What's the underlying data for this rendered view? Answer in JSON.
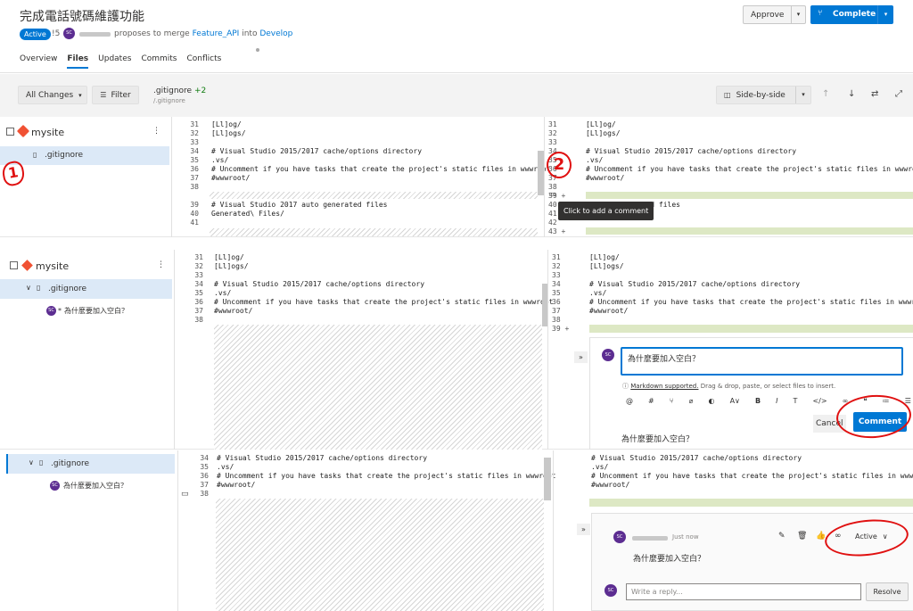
{
  "pr": {
    "title": "完成電話號碼維護功能",
    "status": "Active",
    "id": "!5",
    "avatar": "SC",
    "proposes": "proposes to merge",
    "source": "Feature_API",
    "into": "into",
    "target": "Develop"
  },
  "buttons": {
    "approve": "Approve",
    "complete": "Complete"
  },
  "tabs": [
    "Overview",
    "Files",
    "Updates",
    "Commits",
    "Conflicts"
  ],
  "toolbar": {
    "all_changes": "All Changes",
    "filter": "Filter",
    "file": ".gitignore",
    "delta": "+2",
    "path": "/.gitignore",
    "view": "Side-by-side"
  },
  "tree": {
    "repo": "mysite",
    "file": ".gitignore",
    "comment": "為什麼要加入空白？",
    "comment_bullet": "*"
  },
  "diff1": {
    "left_nums": [
      "31",
      "32",
      "33",
      "34",
      "35",
      "36",
      "37",
      "38",
      "",
      "39",
      "40",
      "41"
    ],
    "left_code": [
      "[Ll]og/",
      "[Ll]ogs/",
      "",
      "# Visual Studio 2015/2017 cache/options directory",
      ".vs/",
      "# Uncomment if you have tasks that create the project's static files in wwwroot",
      "#wwwroot/",
      "",
      "",
      "# Visual Studio 2017 auto generated files",
      "Generated\\ Files/",
      ""
    ],
    "right_nums": [
      "31",
      "32",
      "33",
      "34",
      "35",
      "36",
      "37",
      "38",
      "39 +",
      "40",
      "41",
      "42",
      "43 +"
    ],
    "right_code": [
      "[Ll]og/",
      "[Ll]ogs/",
      "",
      "# Visual Studio 2015/2017 cache/options directory",
      ".vs/",
      "# Uncomment if you have tasks that create the project's static files in wwwroot",
      "#wwwroot/",
      "",
      "",
      "7 auto generated files",
      "",
      "",
      ""
    ],
    "tooltip": "Click to add a comment"
  },
  "diff2": {
    "left_nums": [
      "31",
      "32",
      "33",
      "34",
      "35",
      "36",
      "37",
      "38"
    ],
    "left_code": [
      "[Ll]og/",
      "[Ll]ogs/",
      "",
      "# Visual Studio 2015/2017 cache/options directory",
      ".vs/",
      "# Uncomment if you have tasks that create the project's static files in wwwroot",
      "#wwwroot/",
      ""
    ],
    "right_nums": [
      "31",
      "32",
      "33",
      "34",
      "35",
      "36",
      "37",
      "38",
      "39 +"
    ],
    "right_code": [
      "[Ll]og/",
      "[Ll]ogs/",
      "",
      "# Visual Studio 2015/2017 cache/options directory",
      ".vs/",
      "# Uncomment if you have tasks that create the project's static files in wwwroot",
      "#wwwroot/",
      "",
      ""
    ],
    "comment_input": "為什麼要加入空白？",
    "markdown_link": "Markdown supported.",
    "markdown_hint": " Drag & drop, paste, or select files to insert.",
    "cancel": "Cancel",
    "comment": "Comment",
    "preview": "為什麼要加入空白？"
  },
  "diff3": {
    "left_nums": [
      "34",
      "35",
      "36",
      "37",
      "38"
    ],
    "left_code": [
      "# Visual Studio 2015/2017 cache/options directory",
      ".vs/",
      "# Uncomment if you have tasks that create the project's static files in wwwroot",
      "#wwwroot/",
      ""
    ],
    "right_code": [
      "# Visual Studio 2015/2017 cache/options directory",
      ".vs/",
      "# Uncomment if you have tasks that create the project's static files in wwwroot",
      "#wwwroot/",
      ""
    ],
    "time": "Just now",
    "comment": "為什麼要加入空白？",
    "status": "Active",
    "reply_placeholder": "Write a reply...",
    "resolve": "Resolve"
  },
  "annotations": {
    "one": "1",
    "two": "2"
  },
  "colors": {
    "accent": "#0078d4",
    "active": "#0078d4",
    "add": "#dde8c4",
    "annotation": "#e01010",
    "avatar": "#5c2d91"
  }
}
